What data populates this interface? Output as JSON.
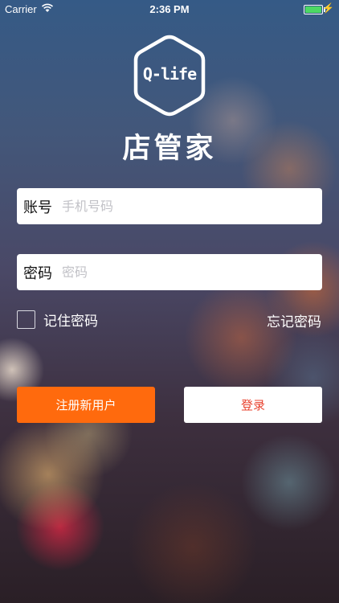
{
  "status_bar": {
    "carrier": "Carrier",
    "time": "2:36 PM",
    "battery_level": 1.0,
    "icons": [
      "wifi-icon",
      "battery-icon",
      "charging-bolt-icon"
    ]
  },
  "brand": {
    "logo_text": "Q-life",
    "app_name": "店管家"
  },
  "login_form": {
    "account_label": "账号",
    "account_placeholder": "手机号码",
    "account_value": "",
    "password_label": "密码",
    "password_placeholder": "密码",
    "password_value": "",
    "remember_label": "记住密码",
    "remember_checked": false,
    "forgot_label": "忘记密码"
  },
  "actions": {
    "register_label": "注册新用户",
    "login_label": "登录"
  },
  "colors": {
    "register_button": "#ff6a0d",
    "login_text": "#e8432f",
    "battery": "#4cd964"
  }
}
